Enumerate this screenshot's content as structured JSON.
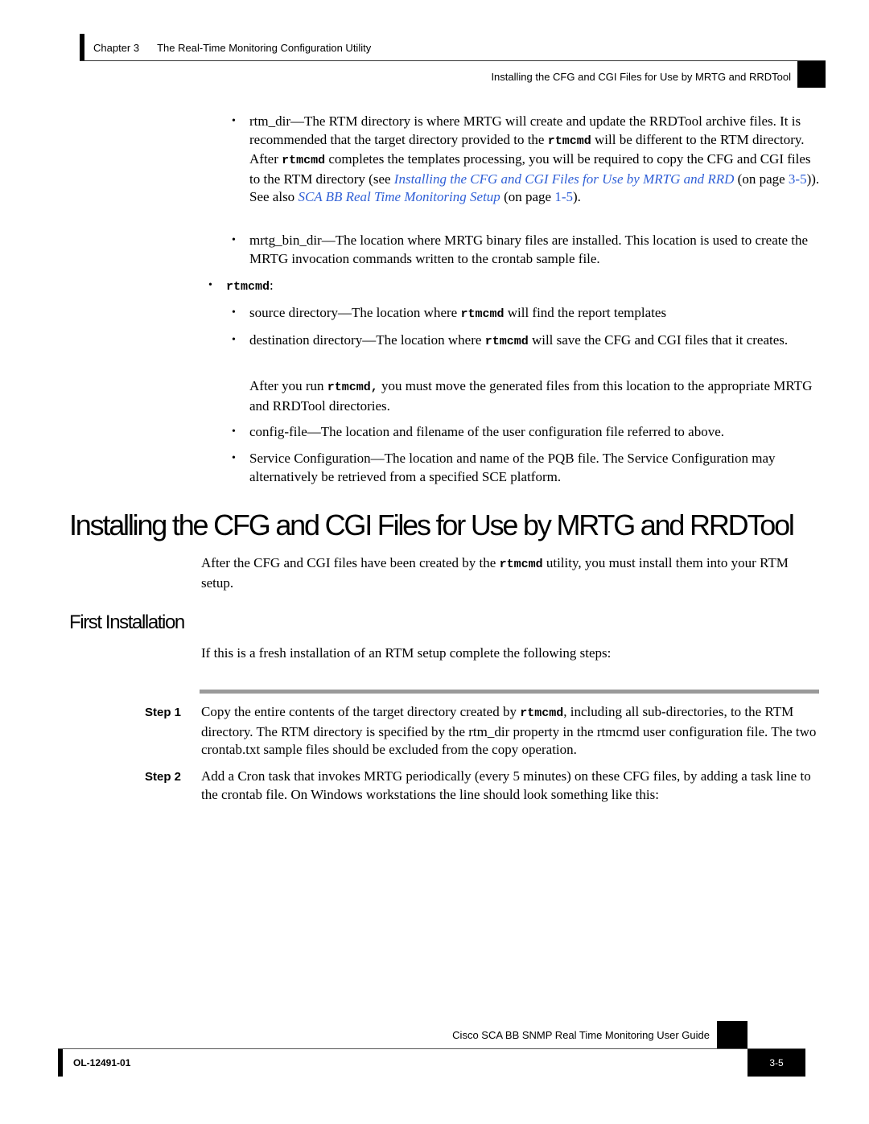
{
  "header": {
    "chapter_label": "Chapter 3",
    "chapter_title": "The Real-Time Monitoring Configuration Utility",
    "section_title": "Installing the CFG and CGI Files for Use by MRTG and RRDTool"
  },
  "bullets_top": {
    "rtm_dir": {
      "t1": "rtm_dir—The RTM directory is where MRTG will create and update the RRDTool archive files. It is recommended that the target directory provided to the ",
      "code1": "rtmcmd",
      "t2": " will be different to the RTM directory. After ",
      "code2": "rtmcmd",
      "t3": " completes the templates processing, you will be required to copy the CFG and CGI files to the RTM directory (see ",
      "link1": "Installing the CFG and CGI Files for Use by MRTG and RRD",
      "t4": " (on page ",
      "page1": "3-5",
      "t5": ")). See also ",
      "link2": "SCA BB Real Time Monitoring Setup",
      "t6": " (on page ",
      "page2": "1-5",
      "t7": ")."
    },
    "mrtg_bin_dir": "mrtg_bin_dir—The location where MRTG binary files are installed. This location is used to create the MRTG invocation commands written to the crontab sample file."
  },
  "rtmcmd_section": {
    "label_code": "rtmcmd",
    "label_suffix": ":",
    "source": {
      "t1": "source directory—The location where ",
      "code": "rtmcmd",
      "t2": " will find the report templates"
    },
    "destination": {
      "t1": "destination directory—The location where ",
      "code": "rtmcmd",
      "t2": " will save the CFG and CGI files that it creates."
    },
    "after_note": {
      "t1": "After you run ",
      "code": "rtmcmd,",
      "t2": "  you must move the generated files from this location to the appropriate MRTG and RRDTool directories."
    },
    "config_file": "config-file—The location and filename of the user configuration file referred to above.",
    "service_config": "Service Configuration—The location and name of the PQB file. The Service Configuration may alternatively be retrieved from a specified SCE platform."
  },
  "section": {
    "heading": "Installing the CFG and CGI Files for Use by MRTG and RRDTool",
    "intro": {
      "t1": "After the CFG and CGI files have been created by the ",
      "code": "rtmcmd",
      "t2": "  utility, you must install them into your RTM setup."
    }
  },
  "first_installation": {
    "heading": "First Installation",
    "intro": "If this is a fresh installation of an RTM setup complete the following steps:",
    "steps": [
      {
        "label": "Step 1",
        "t1": "Copy the entire contents of the target directory created by ",
        "code": "rtmcmd",
        "t2": ", including all sub-directories, to the RTM directory. The RTM directory is specified by the rtm_dir property in the rtmcmd user configuration file. The two crontab.txt sample files should be excluded from the copy operation."
      },
      {
        "label": "Step 2",
        "text": "Add a Cron task that invokes MRTG periodically (every 5 minutes) on these CFG files, by adding a task line to the crontab file. On Windows workstations the line should look something like this:"
      }
    ]
  },
  "footer": {
    "guide_title": "Cisco SCA BB SNMP Real Time Monitoring User Guide",
    "doc_code": "OL-12491-01",
    "page_number": "3-5"
  },
  "colors": {
    "link": "#2f5fd6",
    "rule_gray": "#9a9a9a"
  },
  "icons": {
    "bullet": "bullet-dot-icon"
  }
}
